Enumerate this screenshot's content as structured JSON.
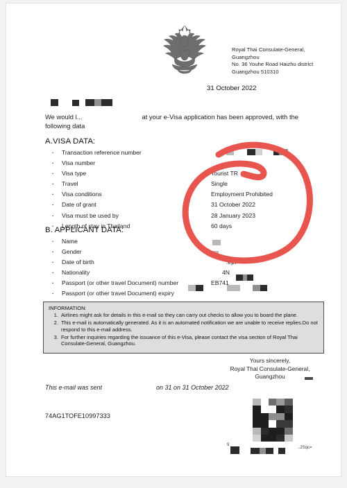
{
  "document": {
    "emblem_name": "thai-garuda-emblem",
    "issuer_address": [
      "Royal Thai Consulate-General,",
      "Guangzhou",
      "No. 36 Youhe Road Haizhu district",
      "Guangzhou 510310"
    ],
    "issue_date": "31 October 2022",
    "salutation_prefix": "We would l...",
    "salutation_suffix": "at your e-Visa application has been approved, with the following data"
  },
  "visa_section": {
    "title": "A.VISA DATA:",
    "labels": [
      "Transaction reference number",
      "Visa number",
      "Visa type",
      "Travel",
      "Visa conditions",
      "Date of grant",
      "Visa must be used by",
      "Length of stay in Thailand"
    ],
    "values": [
      "",
      "",
      "Tourist  TR",
      "Single",
      "Employment Prohibited",
      "31 October 2022",
      "28 January 2023",
      "60 days"
    ]
  },
  "applicant_section": {
    "title": "B. APPLICANT DATA:",
    "labels": [
      "Name",
      "Gender",
      "Date of birth",
      "Nationality",
      "Passport (or other travel Document) number",
      "Passport (or other travel Document) expiry"
    ],
    "values": [
      "",
      "",
      ".ept",
      "4N",
      "EB741",
      ""
    ]
  },
  "information_box": {
    "heading": "INFORMATION:",
    "items": [
      "Airlines might ask for details in this e-mail so they can carry out checks to allow you to board the plane.",
      "This e-mail is automatically generated. As it is an automated notification we are unable to receive replies.Do not respond to this e-mail address.",
      "For further inquiries regarding the issuance of this e-Visa, please contact the visa section of Royal Thai Consulate-General, Guangzhou."
    ]
  },
  "closing": {
    "line1": "Yours sincerely,",
    "line2": "Royal Thai Consulate-General,",
    "line3": "Guangzhou",
    "sent_prefix": "This e-mail was sent",
    "sent_suffix": "on 31  on 31 October 2022"
  },
  "footer": {
    "reference_code": "74AG1TOFE10997333",
    "qr_name": "qr-code-redacted",
    "mark_left": "9",
    "mark_right": "..2Sqc="
  },
  "annotation": {
    "name": "red-circle-highlight",
    "color": "#e8544e"
  }
}
